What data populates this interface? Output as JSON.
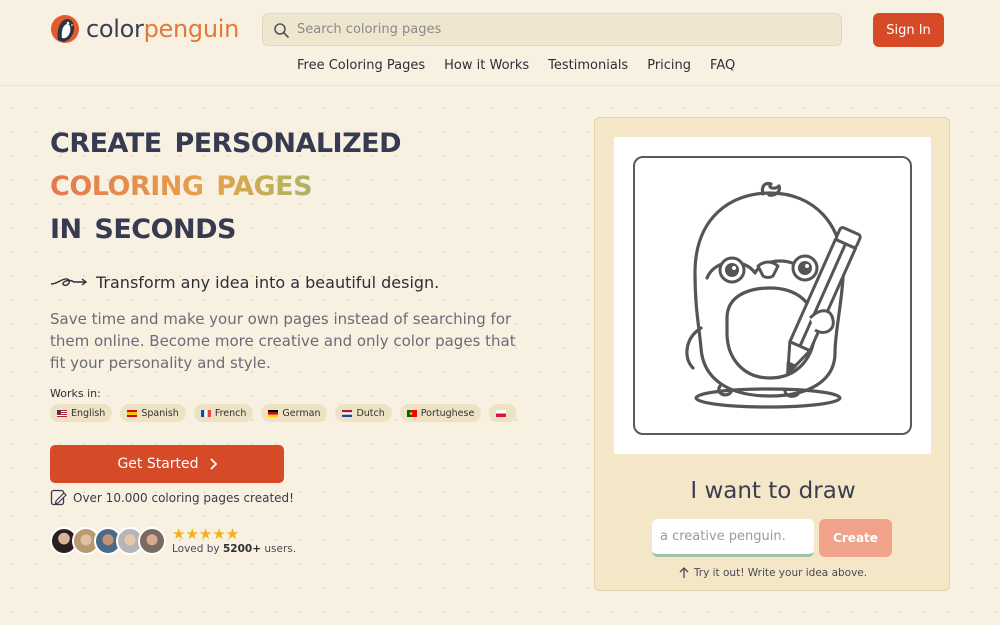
{
  "header": {
    "logo_part1": "color",
    "logo_part2": "penguin",
    "search_placeholder": "Search coloring pages",
    "signin_label": "Sign In",
    "nav": [
      "Free Coloring Pages",
      "How it Works",
      "Testimonials",
      "Pricing",
      "FAQ"
    ]
  },
  "hero": {
    "title_line1": "Create Personalized",
    "title_line2": "Coloring Pages",
    "title_line3": "in Seconds",
    "tagline": "Transform any idea into a beautiful design.",
    "description": "Save time and make your own pages instead of searching for them online. Become more creative and only color pages that fit your personality and style.",
    "works_in_label": "Works in:",
    "languages": [
      {
        "label": "English",
        "flag": "us-flag-icon"
      },
      {
        "label": "Spanish",
        "flag": "es-flag-icon"
      },
      {
        "label": "French",
        "flag": "fr-flag-icon"
      },
      {
        "label": "German",
        "flag": "de-flag-icon"
      },
      {
        "label": "Dutch",
        "flag": "nl-flag-icon"
      },
      {
        "label": "Portughese",
        "flag": "pt-flag-icon"
      },
      {
        "label": "",
        "flag": "flag-icon"
      }
    ],
    "cta_label": "Get Started",
    "stat_text": "Over 10.000 coloring pages created!",
    "rating_stars": 5,
    "loved_prefix": "Loved by ",
    "loved_count": "5200+",
    "loved_suffix": " users."
  },
  "demo": {
    "title": "I want to draw",
    "input_placeholder": "a creative penguin.",
    "create_label": "Create",
    "hint": "Try it out! Write your idea above."
  },
  "colors": {
    "accent": "#d64a28",
    "background": "#f8f1e2",
    "card": "#f3e7c8",
    "star": "#f3b118"
  }
}
